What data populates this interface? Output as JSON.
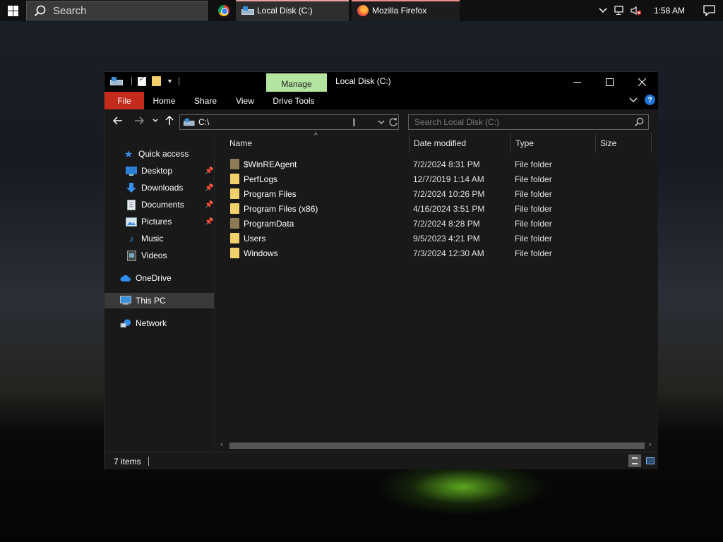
{
  "taskbar": {
    "search_label": "Search",
    "tasks": [
      {
        "label": "Local Disk (C:)",
        "icon": "drive-icon"
      },
      {
        "label": "Mozilla Firefox",
        "icon": "firefox-icon"
      }
    ],
    "clock": "1:58 AM"
  },
  "window": {
    "manage_tab": "Manage",
    "title": "Local Disk (C:)",
    "controls": {
      "minimize": "—",
      "maximize": "☐",
      "close": "✕"
    }
  },
  "ribbon": {
    "tabs": [
      "File",
      "Home",
      "Share",
      "View",
      "Drive Tools"
    ]
  },
  "navigation": {
    "address_value": "C:\\",
    "search_placeholder": "Search Local Disk (C:)"
  },
  "sidebar": {
    "items": [
      {
        "label": "Quick access",
        "icon": "star-icon"
      },
      {
        "label": "Desktop",
        "icon": "desktop-icon",
        "pinned": true
      },
      {
        "label": "Downloads",
        "icon": "download-icon",
        "pinned": true
      },
      {
        "label": "Documents",
        "icon": "documents-icon",
        "pinned": true
      },
      {
        "label": "Pictures",
        "icon": "pictures-icon",
        "pinned": true
      },
      {
        "label": "Music",
        "icon": "music-icon"
      },
      {
        "label": "Videos",
        "icon": "videos-icon"
      },
      {
        "label": "OneDrive",
        "icon": "cloud-icon"
      },
      {
        "label": "This PC",
        "icon": "computer-icon",
        "selected": true
      },
      {
        "label": "Network",
        "icon": "network-icon"
      }
    ]
  },
  "file_list": {
    "columns": [
      "Name",
      "Date modified",
      "Type",
      "Size"
    ],
    "rows": [
      {
        "name": "$WinREAgent",
        "date": "7/2/2024 8:31 PM",
        "type": "File folder",
        "hidden": true
      },
      {
        "name": "PerfLogs",
        "date": "12/7/2019 1:14 AM",
        "type": "File folder",
        "hidden": false
      },
      {
        "name": "Program Files",
        "date": "7/2/2024 10:26 PM",
        "type": "File folder",
        "hidden": false
      },
      {
        "name": "Program Files (x86)",
        "date": "4/16/2024 3:51 PM",
        "type": "File folder",
        "hidden": false
      },
      {
        "name": "ProgramData",
        "date": "7/2/2024 8:28 PM",
        "type": "File folder",
        "hidden": true
      },
      {
        "name": "Users",
        "date": "9/5/2023 4:21 PM",
        "type": "File folder",
        "hidden": false
      },
      {
        "name": "Windows",
        "date": "7/3/2024 12:30 AM",
        "type": "File folder",
        "hidden": false
      }
    ]
  },
  "status": {
    "item_count": "7 items"
  },
  "colors": {
    "file_tab": "#c42b1c",
    "manage_tab": "#b3e5a0",
    "folder": "#f2d06b",
    "selection": "#3a3a3a"
  }
}
